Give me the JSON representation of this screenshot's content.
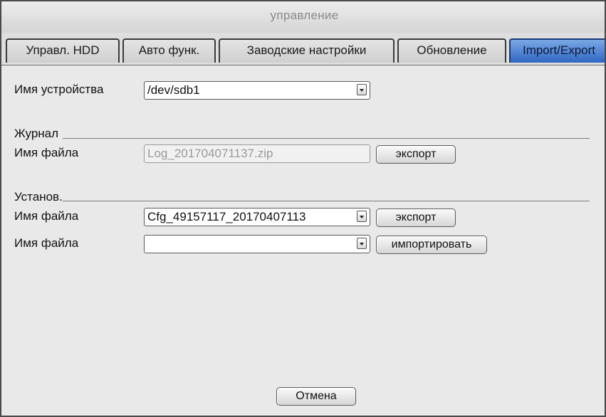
{
  "window": {
    "title": "управление"
  },
  "tabs": [
    {
      "label": "Управл. HDD",
      "active": false
    },
    {
      "label": "Авто функ.",
      "active": false
    },
    {
      "label": "Заводские настройки",
      "active": false
    },
    {
      "label": "Обновление",
      "active": false
    },
    {
      "label": "Import/Export",
      "active": true
    }
  ],
  "device": {
    "label": "Имя устройства",
    "value": "/dev/sdb1"
  },
  "journal": {
    "section_label": "Журнал",
    "file_label": "Имя файла",
    "file_value": "Log_201704071137.zip",
    "export_label": "экспорт"
  },
  "settings": {
    "section_label": "Установ.",
    "export_file_label": "Имя файла",
    "export_file_value": "Cfg_49157117_20170407113",
    "export_label": "экспорт",
    "import_file_label": "Имя файла",
    "import_file_value": "",
    "import_label": "импортировать"
  },
  "footer": {
    "cancel_label": "Отмена"
  },
  "colors": {
    "active_tab": "#2f67c2",
    "window_bg": "#e9e9e9",
    "border": "#4a4a4a"
  }
}
